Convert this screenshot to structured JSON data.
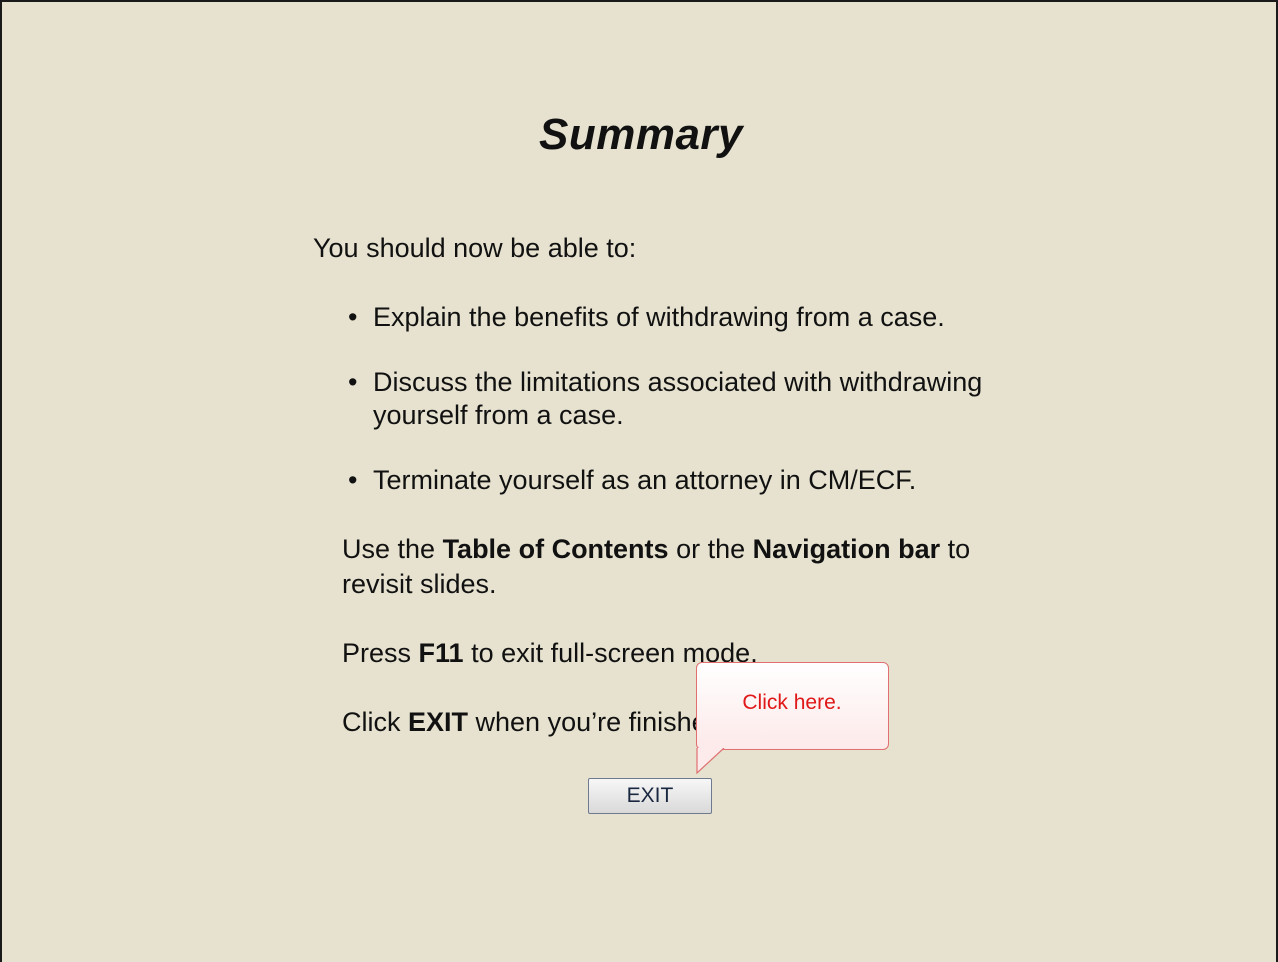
{
  "slide": {
    "title": "Summary",
    "intro": "You should now be able to:",
    "bullets": [
      {
        "dot": "•",
        "text": "Explain the benefits of withdrawing from a case."
      },
      {
        "dot": "•",
        "text": "Discuss the limitations associated with withdrawing yourself from a case."
      },
      {
        "dot": "•",
        "text": "Terminate yourself as an attorney in CM/ECF."
      }
    ],
    "nav_tip": {
      "pre": "Use the ",
      "toc": "Table of Contents",
      "mid": " or the ",
      "navbar": "Navigation bar",
      "post": " to revisit slides."
    },
    "f11_tip": {
      "pre": "Press ",
      "key": "F11",
      "post": " to exit full-screen mode."
    },
    "exit_tip": {
      "pre": "Click ",
      "key": "EXIT",
      "post": " when you’re finished."
    },
    "exit_button": "EXIT",
    "callout": "Click here."
  },
  "colors": {
    "background": "#e6e2cf",
    "callout_text": "#e01818",
    "callout_border": "#e07070"
  }
}
